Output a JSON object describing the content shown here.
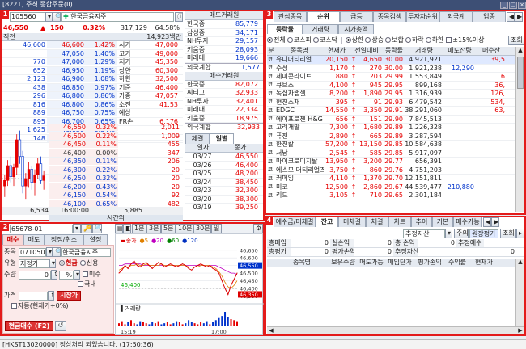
{
  "window": {
    "title": "[8221] 주식 종합주문(II)",
    "controls": [
      "_",
      "□",
      "×"
    ]
  },
  "badges": [
    "1",
    "2",
    "3",
    "4"
  ],
  "p1": {
    "code": "105560",
    "name": "한국금융지주",
    "price": "46,550",
    "change": "150",
    "rate": "0.32%",
    "volume": "317,129",
    "trade_rate": "64.58%",
    "header": {
      "col1": "직전",
      "col2": "14,923백만"
    },
    "asks": [
      {
        "qty": "46,600",
        "price": "46,600",
        "pct": "1.42%"
      },
      {
        "qty": "",
        "price": "47,050",
        "pct": "1.40%"
      },
      {
        "qty": "770",
        "price": "47,000",
        "pct": "1.29%"
      },
      {
        "qty": "652",
        "price": "46,950",
        "pct": "1.19%"
      },
      {
        "qty": "2,123",
        "price": "46,900",
        "pct": "1.08%"
      },
      {
        "qty": "438",
        "price": "46,850",
        "pct": "0.97%"
      },
      {
        "qty": "296",
        "price": "46,800",
        "pct": "0.86%"
      },
      {
        "qty": "816",
        "price": "46,800",
        "pct": "0.86%"
      },
      {
        "qty": "889",
        "price": "46,750",
        "pct": "0.75%"
      },
      {
        "qty": "895",
        "price": "46,700",
        "pct": "0.65%"
      },
      {
        "qty": "1,625",
        "price": "46,650",
        "pct": "0.54%"
      },
      {
        "qty": "148",
        "price": "46,600",
        "pct": "0.43%"
      }
    ],
    "info": [
      {
        "k": "시가",
        "v": "47,000"
      },
      {
        "k": "고가",
        "v": "49,000"
      },
      {
        "k": "저가",
        "v": "45,350"
      },
      {
        "k": "상한",
        "v": "60,300"
      },
      {
        "k": "하한",
        "v": "32,500"
      },
      {
        "k": "기준",
        "v": "46,400"
      },
      {
        "k": "가중",
        "v": "47,057"
      },
      {
        "k": "소진",
        "v": "41.53"
      },
      {
        "k": "예상",
        "v": ""
      },
      {
        "k": "FR손",
        "v": "6,176"
      }
    ],
    "bids": [
      {
        "price": "46,550",
        "pct": "0.32%",
        "qty": "2,011"
      },
      {
        "price": "46,500",
        "pct": "0.22%",
        "qty": "1,009"
      },
      {
        "price": "46,450",
        "pct": "0.11%",
        "qty": "455"
      },
      {
        "price": "46,400",
        "pct": "0.00%",
        "qty": "347"
      },
      {
        "price": "46,350",
        "pct": "0.11%",
        "qty": "206"
      },
      {
        "price": "46,300",
        "pct": "0.22%",
        "qty": "20"
      },
      {
        "price": "46,250",
        "pct": "0.32%",
        "qty": "20"
      },
      {
        "price": "46,200",
        "pct": "0.43%",
        "qty": "20"
      },
      {
        "price": "46,150",
        "pct": "0.54%",
        "qty": "92"
      },
      {
        "price": "46,100",
        "pct": "0.65%",
        "qty": "482"
      }
    ],
    "foot": {
      "ask_total": "6,534",
      "ask_diff": "16:00:00",
      "bid_total": "5,885",
      "label": "시간외"
    },
    "brokers_header": "매도거래원",
    "sell_brokers": [
      {
        "n": "한국증",
        "v": "85,779"
      },
      {
        "n": "삼성증",
        "v": "34,171"
      },
      {
        "n": "NH투자",
        "v": "29,157"
      },
      {
        "n": "키움증",
        "v": "28,093"
      },
      {
        "n": "미래대",
        "v": "19,666"
      }
    ],
    "sell_foreign": {
      "n": "외국계합",
      "v": "1,577"
    },
    "buy_header": "매수거래원",
    "buy_brokers": [
      {
        "n": "한국증",
        "v": "82,072"
      },
      {
        "n": "씨티그",
        "v": "32,933"
      },
      {
        "n": "NH투자",
        "v": "32,401"
      },
      {
        "n": "미래대",
        "v": "22,334"
      },
      {
        "n": "키움증",
        "v": "18,975"
      }
    ],
    "buy_foreign": {
      "n": "외국계합",
      "v": "32,933"
    },
    "day_tabs": [
      "체결",
      "일별"
    ],
    "day_header": [
      "일자",
      "종가"
    ],
    "days": [
      {
        "d": "03/27",
        "v": "46,550"
      },
      {
        "d": "03/26",
        "v": "46,400"
      },
      {
        "d": "03/25",
        "v": "48,200"
      },
      {
        "d": "03/24",
        "v": "38,450"
      },
      {
        "d": "03/23",
        "v": "32,300"
      },
      {
        "d": "03/20",
        "v": "38,300"
      },
      {
        "d": "03/19",
        "v": "39,250"
      }
    ]
  },
  "mini_chart": {
    "type": "candlestick",
    "candles": [
      [
        46.0,
        46.6,
        45.4,
        46.3
      ],
      [
        46.3,
        47.4,
        46.0,
        47.1
      ],
      [
        47.1,
        47.6,
        46.2,
        46.5
      ],
      [
        46.5,
        47.2,
        46.0,
        47.0
      ],
      [
        47.0,
        48.8,
        46.6,
        48.5
      ],
      [
        48.5,
        49.0,
        47.2,
        47.6
      ],
      [
        47.6,
        47.9,
        45.6,
        46.0
      ],
      [
        46.0,
        46.7,
        45.3,
        46.4
      ],
      [
        46.4,
        47.3,
        45.9,
        46.9
      ],
      [
        46.9,
        47.1,
        45.8,
        46.2
      ],
      [
        46.2,
        46.9,
        45.5,
        46.6
      ],
      [
        46.6,
        47.5,
        46.4,
        47.2
      ],
      [
        47.2,
        47.6,
        46.1,
        46.3
      ],
      [
        46.3,
        46.8,
        45.8,
        46.55
      ]
    ],
    "ylim": [
      45.0,
      49.2
    ]
  },
  "p2": {
    "account": "65678-01",
    "tabs": [
      "매수",
      "매도",
      "정정/취소",
      "설정"
    ],
    "code": "071050",
    "name": "한국금융지주",
    "type_label": "유형",
    "type_value": "지정가",
    "credit": [
      "현금",
      "신용"
    ],
    "qty_label": "수량",
    "qty_value": "0",
    "pct_value": "%",
    "checks": [
      "미수",
      "국내"
    ],
    "price_label": "가격",
    "market_btn": "시장가",
    "auto_label": "자동(현재가+0%)",
    "order_btn": "현금매수 (F2)",
    "chart_tabs": [
      "1분",
      "3분",
      "5분",
      "10분",
      "30분",
      "일"
    ],
    "chart_legend": [
      "종가",
      "5",
      "20",
      "60",
      "120"
    ],
    "y_ticks": [
      "46,650",
      "46,600",
      "46,550",
      "46,500",
      "46,450",
      "46,400",
      "46,350"
    ],
    "last_label": "46,550",
    "cur_label": "46,350",
    "base_label": "46,400",
    "vol_label": "거래량",
    "x_ticks": [
      "15:19",
      "17:00"
    ]
  },
  "intraday_chart": {
    "type": "line",
    "close": [
      46.5,
      46.52,
      46.55,
      46.53,
      46.56,
      46.58,
      46.55,
      46.54,
      46.56,
      46.57,
      46.55,
      46.53,
      46.55,
      46.57,
      46.56,
      46.54,
      46.55,
      46.56,
      46.55,
      46.54,
      46.55,
      46.56,
      46.55,
      46.53,
      46.52,
      46.54,
      46.55,
      46.56,
      46.55,
      46.54,
      46.55,
      46.53,
      46.52,
      46.5,
      46.45,
      46.4,
      46.36,
      46.42,
      46.46,
      46.5
    ],
    "ma5": [
      46.52,
      46.53,
      46.54,
      46.54,
      46.55,
      46.55,
      46.56,
      46.55,
      46.55,
      46.56,
      46.55,
      46.55,
      46.55,
      46.55,
      46.56,
      46.55,
      46.55,
      46.55,
      46.55,
      46.55,
      46.55,
      46.55,
      46.55,
      46.54,
      46.54,
      46.54,
      46.54,
      46.55,
      46.55,
      46.55,
      46.55,
      46.54,
      46.53,
      46.51,
      46.48,
      46.44,
      46.41,
      46.4,
      46.42,
      46.45
    ],
    "ma20": [
      46.55,
      46.55,
      46.56,
      46.56,
      46.56,
      46.56,
      46.56,
      46.56,
      46.55,
      46.55,
      46.55,
      46.55,
      46.55,
      46.55,
      46.55,
      46.55,
      46.55,
      46.55,
      46.55,
      46.55,
      46.55,
      46.55,
      46.55,
      46.55,
      46.55,
      46.55,
      46.55,
      46.55,
      46.55,
      46.55,
      46.55,
      46.55,
      46.55,
      46.54,
      46.53,
      46.52,
      46.51,
      46.5,
      46.5,
      46.49
    ],
    "volume": [
      3,
      5,
      2,
      4,
      6,
      3,
      2,
      5,
      4,
      3,
      2,
      4,
      3,
      5,
      2,
      3,
      4,
      2,
      3,
      5,
      4,
      2,
      3,
      6,
      4,
      3,
      2,
      4,
      3,
      5,
      2,
      4,
      6,
      8,
      10,
      14,
      9,
      7,
      6,
      5
    ],
    "ylim": [
      46.32,
      46.67
    ]
  },
  "p3": {
    "tabs": [
      "관심종목",
      "순위",
      "급등",
      "종목검색",
      "투자자순위",
      "외국계",
      "업종"
    ],
    "sub_tabs": [
      "등락률",
      "거래량",
      "시가총액"
    ],
    "market": [
      "전체",
      "코스피",
      "코스닥"
    ],
    "filter": [
      "상한",
      "상승",
      "보합",
      "하락",
      "하한"
    ],
    "limit": "±15%이상",
    "search_btn": "조회",
    "columns": [
      "분",
      "종목명",
      "현재가",
      "전일대비",
      "등락률",
      "거래량",
      "매도잔량",
      "매수잔"
    ],
    "rows": [
      {
        "f": "코",
        "n": "유니머티리얼",
        "p": "20,150",
        "a": "↑",
        "c": "4,650",
        "r": "30.00",
        "v": "4,921,921",
        "s": "",
        "b": "39,5",
        "dir": "up"
      },
      {
        "f": "코",
        "n": "수성",
        "p": "1,170",
        "a": "↑",
        "c": "270",
        "r": "30.00",
        "v": "1,921,238",
        "s": "12,290",
        "b": "",
        "dir": "up"
      },
      {
        "f": "코",
        "n": "세미콘라이트",
        "p": "880",
        "a": "↑",
        "c": "203",
        "r": "29.99",
        "v": "1,553,849",
        "s": "",
        "b": "6",
        "dir": "up"
      },
      {
        "f": "코",
        "n": "큐브스",
        "p": "4,100",
        "a": "↑",
        "c": "945",
        "r": "29.95",
        "v": "899,168",
        "s": "",
        "b": "36,",
        "dir": "up"
      },
      {
        "f": "코",
        "n": "녹십자랩셀",
        "p": "8,200",
        "a": "↑",
        "c": "1,890",
        "r": "29.95",
        "v": "1,316,939",
        "s": "",
        "b": "126,",
        "dir": "up"
      },
      {
        "f": "코",
        "n": "현진소재",
        "p": "395",
        "a": "↑",
        "c": "91",
        "r": "29.93",
        "v": "6,479,542",
        "s": "",
        "b": "534,",
        "dir": "up"
      },
      {
        "f": "코",
        "n": "EDGC",
        "p": "14,550",
        "a": "↑",
        "c": "3,350",
        "r": "29.91",
        "v": "38,291,060",
        "s": "",
        "b": "63,",
        "dir": "up"
      },
      {
        "f": "코",
        "n": "에이프로젠 H&G",
        "p": "656",
        "a": "↑",
        "c": "151",
        "r": "29.90",
        "v": "7,845,513",
        "s": "",
        "b": "",
        "dir": "up"
      },
      {
        "f": "코",
        "n": "고려개발",
        "p": "7,300",
        "a": "↑",
        "c": "1,680",
        "r": "29.89",
        "v": "1,226,328",
        "s": "",
        "b": "",
        "dir": "up"
      },
      {
        "f": "코",
        "n": "퓨전",
        "p": "2,890",
        "a": "↑",
        "c": "665",
        "r": "29.89",
        "v": "3,287,594",
        "s": "",
        "b": "",
        "dir": "up"
      },
      {
        "f": "코",
        "n": "한진칼",
        "p": "57,200",
        "a": "↑",
        "c": "13,150",
        "r": "29.85",
        "v": "10,584,638",
        "s": "",
        "b": "",
        "dir": "up"
      },
      {
        "f": "코",
        "n": "서남",
        "p": "2,545",
        "a": "↑",
        "c": "585",
        "r": "29.85",
        "v": "5,917,097",
        "s": "",
        "b": "",
        "dir": "up"
      },
      {
        "f": "코",
        "n": "마이크로디지탈",
        "p": "13,950",
        "a": "↑",
        "c": "3,200",
        "r": "29.77",
        "v": "656,391",
        "s": "",
        "b": "",
        "dir": "up"
      },
      {
        "f": "코",
        "n": "에스모 머티리얼즈",
        "p": "3,750",
        "a": "↑",
        "c": "860",
        "r": "29.76",
        "v": "4,751,203",
        "s": "",
        "b": "",
        "dir": "up"
      },
      {
        "f": "코",
        "n": "커머잉",
        "p": "4,110",
        "a": "↑",
        "c": "1,370",
        "r": "29.70",
        "v": "12,151,811",
        "s": "",
        "b": "",
        "dir": "up"
      },
      {
        "f": "코",
        "n": "미코",
        "p": "12,500",
        "a": "↑",
        "c": "2,860",
        "r": "29.67",
        "v": "44,539,477",
        "s": "210,880",
        "b": "",
        "dir": "up"
      },
      {
        "f": "코",
        "n": "리드",
        "p": "3,105",
        "a": "↑",
        "c": "710",
        "r": "29.65",
        "v": "2,301,184",
        "s": "",
        "b": "",
        "dir": "up"
      }
    ]
  },
  "p4": {
    "tabs": [
      "예수금/미체결",
      "잔고",
      "미체결",
      "체결",
      "차트",
      "추이",
      "기본",
      "매수가능"
    ],
    "account_select": "추정자산",
    "note_btn": "주의",
    "basis": "원장평가",
    "search_btn": "조회",
    "summary": [
      {
        "k": "총매입",
        "v": "0",
        "k2": "실손익",
        "v2": "0",
        "k3": "총 손익",
        "v3": "0",
        "k4": "추정예수",
        "v4": ""
      },
      {
        "k": "총평가",
        "v": "0",
        "k2": "평가손익",
        "v2": "0",
        "k3": "추정자산",
        "v3": "",
        "k4": "",
        "v4": "0"
      }
    ],
    "columns": [
      "",
      "종목명",
      "보유수량",
      "매도가능",
      "매입단가",
      "평가손익",
      "수익률",
      "현재가"
    ]
  },
  "status": {
    "text": "[HKST13020000] 정상처리 되었습니다. (17:50:36)"
  }
}
